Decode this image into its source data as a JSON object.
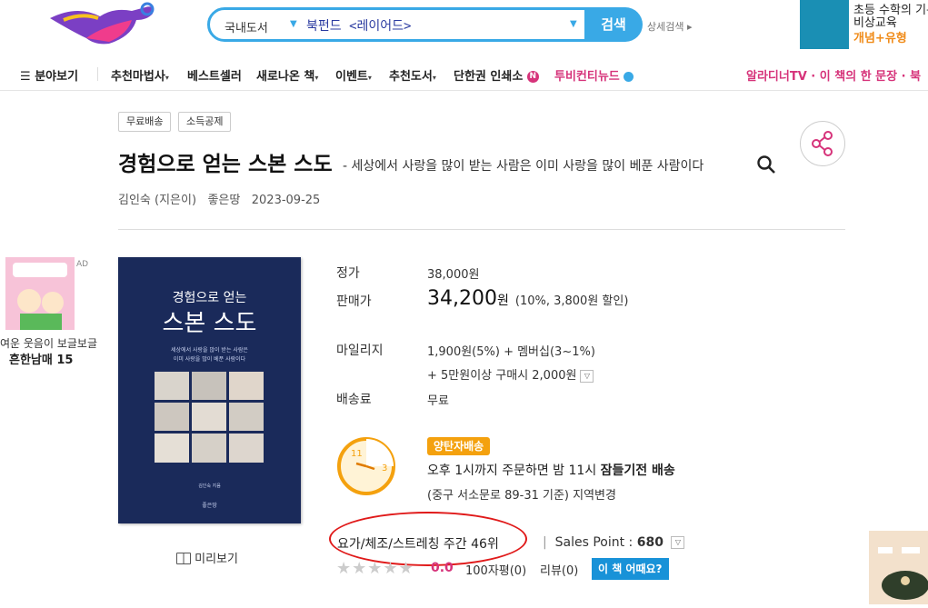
{
  "header": {
    "search": {
      "category": "국내도서",
      "query": "북펀드 <레이어드>",
      "button_label": "검색",
      "advanced_label": "상세검색 ▸"
    },
    "top_ad": {
      "line1": "초등 수학의 기본",
      "line2": "비상교육",
      "line3": "개념+유형"
    }
  },
  "nav": {
    "menu_label": "분야보기",
    "items": [
      {
        "label": "추천마법사"
      },
      {
        "label": "베스트셀러"
      },
      {
        "label": "새로나온 책"
      },
      {
        "label": "이벤트"
      },
      {
        "label": "추천도서"
      },
      {
        "label": "단한권 인쇄소"
      },
      {
        "label": "투비컨티뉴드"
      }
    ],
    "new_badge": "N",
    "right_text": "알라디너TV · 이 책의 한 문장 · 북"
  },
  "product": {
    "tags": [
      "무료배송",
      "소득공제"
    ],
    "title": "경험으로 얻는 스본 스도",
    "subtitle": "- 세상에서 사랑을 많이 받는 사람은 이미 사랑을 많이 베푼 사람이다",
    "author": "김인숙 (지은이)",
    "publisher": "좋은땅",
    "date": "2023-09-25",
    "cover": {
      "title_top": "경험으로 얻는",
      "title_main": "스본 스도",
      "sub1": "세상에서 사랑을 많이 받는 사람은",
      "sub2": "이미 사랑을 많이 베푼 사람이다",
      "author": "김인숙 지음",
      "publisher": "좋은땅"
    },
    "preview_label": "미리보기",
    "price_label": "정가",
    "price": "38,000원",
    "sale_label": "판매가",
    "sale_price": "34,200",
    "sale_unit": "원",
    "discount": "(10%, 3,800원 할인)",
    "mileage_label": "마일리지",
    "mileage": "1,900원(5%)  +  멤버십(3~1%)",
    "mileage_extra": "+ 5만원이상 구매시 2,000원",
    "shipping_label": "배송료",
    "shipping": "무료",
    "delivery": {
      "badge": "양탄자배송",
      "line1_prefix": "오후 1시까지 주문하면 밤 11시 ",
      "line1_bold": "잠들기전 배송",
      "line2": "(중구 서소문로 89-31 기준) 지역변경"
    },
    "rank": "요가/체조/스트레칭 주간 46위",
    "sales_point_label": "Sales Point :",
    "sales_point": "680",
    "rating": "0.0",
    "review100": "100자평(0)",
    "review": "리뷰(0)",
    "how_label": "이 책 어때요?"
  },
  "left_ad": {
    "mark": "AD",
    "copy": "여운 웃음이 보글보글",
    "title": "흔한남매 15"
  },
  "colors": {
    "brand": "#39a9e6",
    "accent_pink": "#d6337a",
    "delivery": "#f4a10e",
    "rank_circle": "#e01a1a"
  }
}
